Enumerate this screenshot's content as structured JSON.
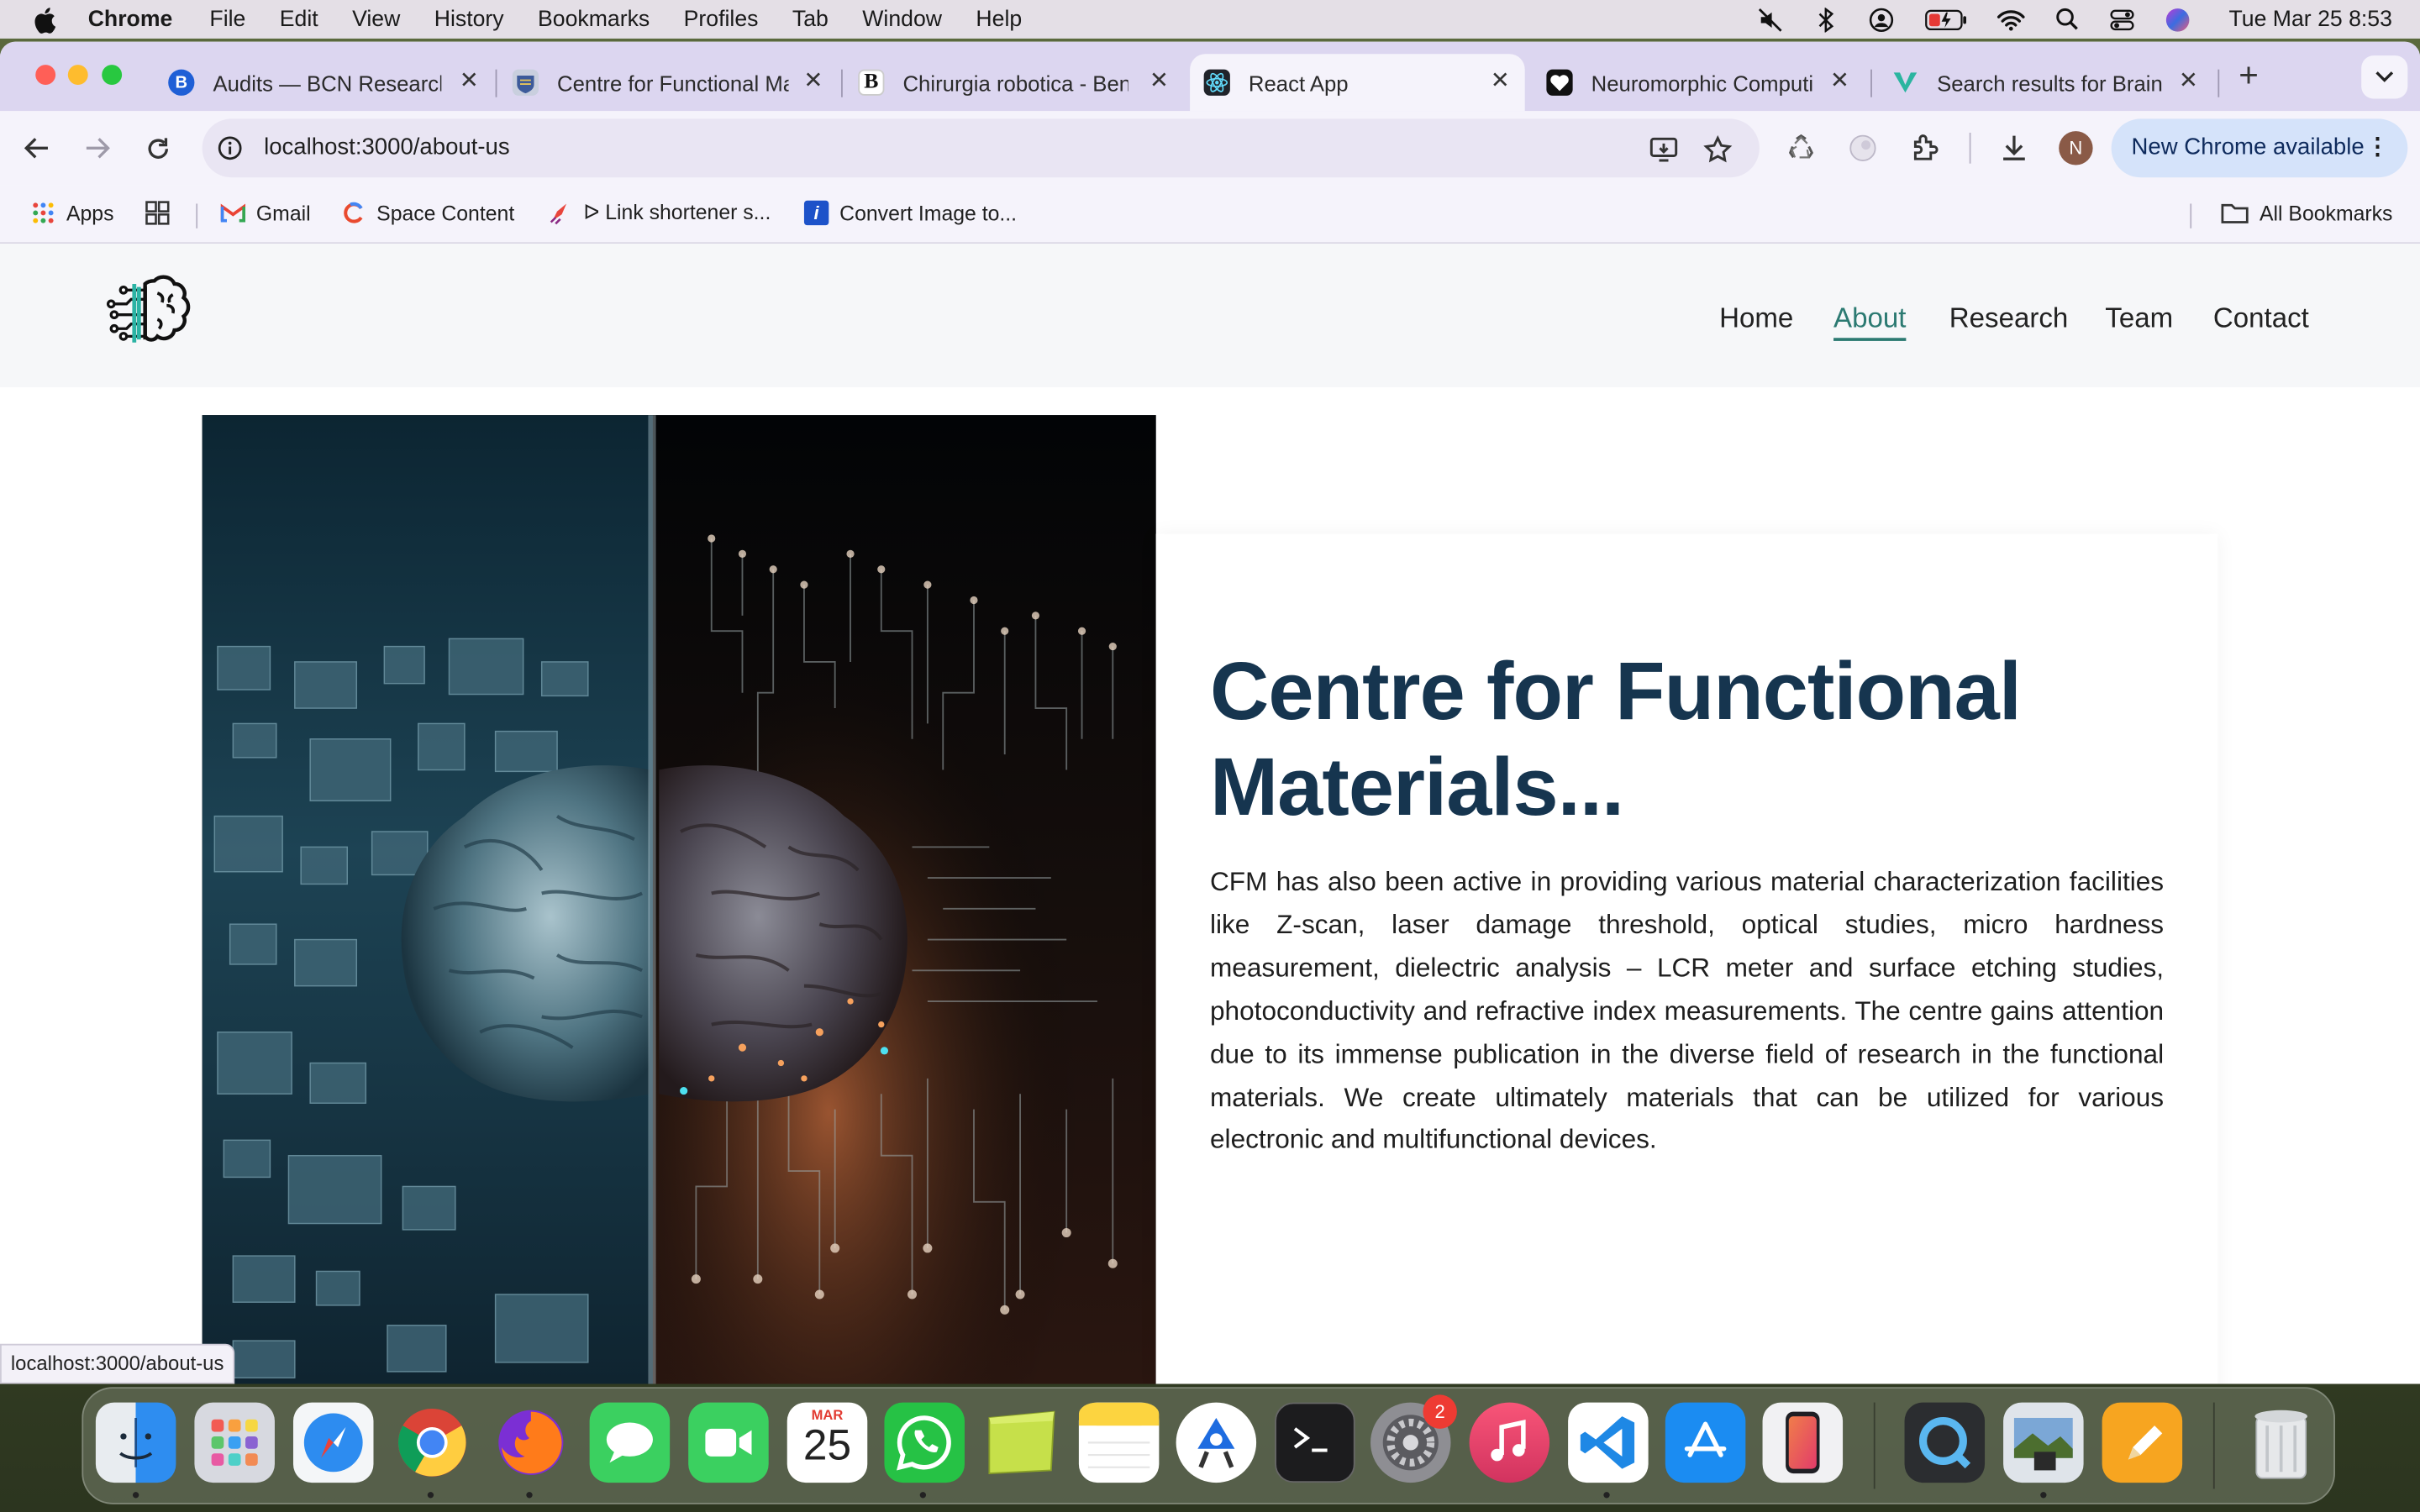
{
  "menubar": {
    "app_name": "Chrome",
    "items": [
      "File",
      "Edit",
      "View",
      "History",
      "Bookmarks",
      "Profiles",
      "Tab",
      "Window",
      "Help"
    ],
    "clock": "Tue Mar 25  8:53"
  },
  "tabs": [
    {
      "title": "Audits — BCN Research",
      "favicon": "B",
      "color": "#1f5fd6"
    },
    {
      "title": "Centre for Functional Ma",
      "favicon": "",
      "color": "#b8bfd0"
    },
    {
      "title": "Chirurgia robotica - Ben",
      "favicon": "B",
      "color": "#ffffff"
    },
    {
      "title": "React App",
      "favicon": "",
      "color": "#222222"
    },
    {
      "title": "Neuromorphic Computi",
      "favicon": "",
      "color": "#111111"
    },
    {
      "title": "Search results for Brain",
      "favicon": "V",
      "color": "#2bb5a0"
    }
  ],
  "toolbar": {
    "url": "localhost:3000/about-us",
    "update_label": "New Chrome available",
    "profile_initial": "N"
  },
  "bookmarks": [
    {
      "label": "Apps"
    },
    {
      "label": "Gmail"
    },
    {
      "label": "Space Content"
    },
    {
      "label": "ᐅ Link shortener s..."
    },
    {
      "label": "Convert Image to..."
    }
  ],
  "all_bookmarks": "All Bookmarks",
  "site": {
    "nav": [
      "Home",
      "About",
      "Research",
      "Team",
      "Contact"
    ],
    "active_nav": "About",
    "heading": "Centre for Functional Materials...",
    "body": "CFM has also been active in providing various material characterization facilities like Z-scan, laser damage threshold, optical studies, micro hardness measurement, dielectric analysis – LCR meter and surface etching studies, photoconductivity and refractive index measurements. The centre gains attention due to its immense publication in the diverse field of research in the functional materials. We create ultimately materials that can be utilized for various electronic and multifunctional devices."
  },
  "status_url": "localhost:3000/about-us",
  "dock": {
    "calendar_month": "MAR",
    "calendar_day": "25",
    "settings_badge": "2"
  },
  "colors": {
    "heading": "#16354f",
    "nav_active": "#2c7a72",
    "tabstrip": "#dcd6f0"
  }
}
